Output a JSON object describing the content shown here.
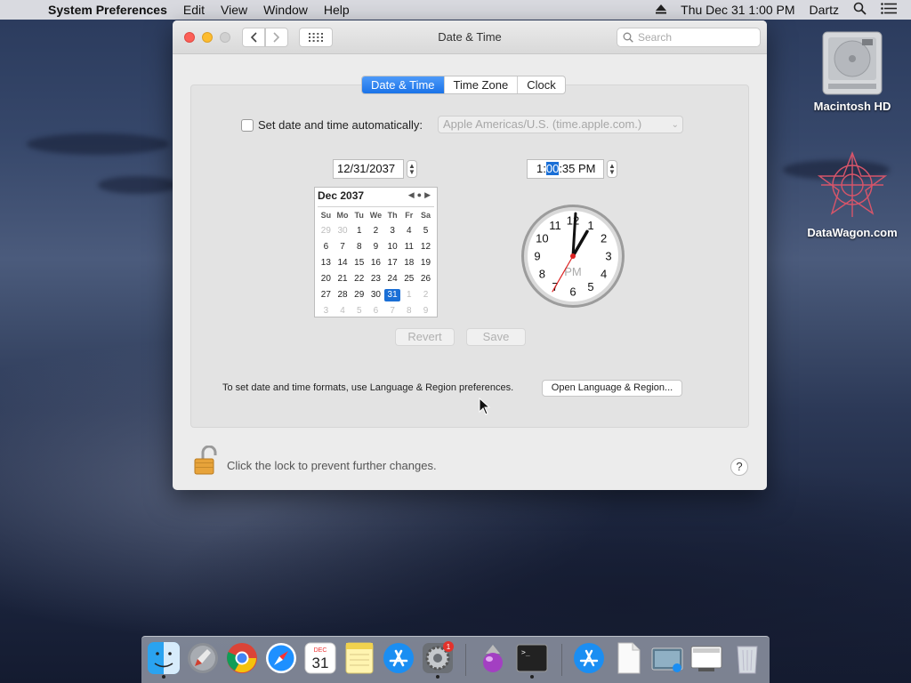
{
  "menubar": {
    "apple_glyph": "",
    "app_name": "System Preferences",
    "items": [
      "Edit",
      "View",
      "Window",
      "Help"
    ],
    "clock": "Thu Dec 31  1:00 PM",
    "user": "Dartz"
  },
  "window": {
    "title": "Date & Time",
    "search_placeholder": "Search",
    "tabs": [
      {
        "label": "Date & Time",
        "active": true
      },
      {
        "label": "Time Zone",
        "active": false
      },
      {
        "label": "Clock",
        "active": false
      }
    ],
    "auto_label": "Set date and time automatically:",
    "auto_checked": false,
    "time_server": "Apple Americas/U.S. (time.apple.com.)",
    "date_value": "12/31/2037",
    "time": {
      "hour": "1:",
      "minute": "00",
      "rest": ":35 PM"
    },
    "calendar": {
      "month_label": "Dec 2037",
      "dow": [
        "Su",
        "Mo",
        "Tu",
        "We",
        "Th",
        "Fr",
        "Sa"
      ],
      "weeks": [
        [
          [
            "29",
            "dim"
          ],
          [
            "30",
            "dim"
          ],
          [
            "1",
            ""
          ],
          [
            "2",
            ""
          ],
          [
            "3",
            ""
          ],
          [
            "4",
            ""
          ],
          [
            "5",
            ""
          ]
        ],
        [
          [
            "6",
            ""
          ],
          [
            "7",
            ""
          ],
          [
            "8",
            ""
          ],
          [
            "9",
            ""
          ],
          [
            "10",
            ""
          ],
          [
            "11",
            ""
          ],
          [
            "12",
            ""
          ]
        ],
        [
          [
            "13",
            ""
          ],
          [
            "14",
            ""
          ],
          [
            "15",
            ""
          ],
          [
            "16",
            ""
          ],
          [
            "17",
            ""
          ],
          [
            "18",
            ""
          ],
          [
            "19",
            ""
          ]
        ],
        [
          [
            "20",
            ""
          ],
          [
            "21",
            ""
          ],
          [
            "22",
            ""
          ],
          [
            "23",
            ""
          ],
          [
            "24",
            ""
          ],
          [
            "25",
            ""
          ],
          [
            "26",
            ""
          ]
        ],
        [
          [
            "27",
            ""
          ],
          [
            "28",
            ""
          ],
          [
            "29",
            ""
          ],
          [
            "30",
            ""
          ],
          [
            "31",
            "today"
          ],
          [
            "1",
            "dim"
          ],
          [
            "2",
            "dim"
          ]
        ],
        [
          [
            "3",
            "dim"
          ],
          [
            "4",
            "dim"
          ],
          [
            "5",
            "dim"
          ],
          [
            "6",
            "dim"
          ],
          [
            "7",
            "dim"
          ],
          [
            "8",
            "dim"
          ],
          [
            "9",
            "dim"
          ]
        ]
      ]
    },
    "clock_face": {
      "numbers": [
        "12",
        "1",
        "2",
        "3",
        "4",
        "5",
        "6",
        "7",
        "8",
        "9",
        "10",
        "11"
      ],
      "ampm": "PM",
      "hour": 1,
      "minute": 0,
      "second": 35
    },
    "revert_label": "Revert",
    "save_label": "Save",
    "hint": "To set date and time formats, use Language & Region preferences.",
    "open_region_label": "Open Language & Region...",
    "lock_text": "Click the lock to prevent further changes.",
    "help_label": "?"
  },
  "desktop": {
    "icons": [
      {
        "label": "Macintosh HD",
        "icon": "hard-drive-icon"
      },
      {
        "label": "DataWagon.com",
        "icon": "datawagon-logo-icon"
      }
    ]
  },
  "dock": {
    "items": [
      "finder-icon",
      "launchpad-icon",
      "chrome-icon",
      "safari-icon",
      "calendar-icon",
      "notes-icon",
      "app-store-icon",
      "system-preferences-icon",
      "installer-icon",
      "terminal-icon",
      "downloads-icon",
      "document-icon",
      "screenshot-icon",
      "xquartz-icon",
      "trash-icon"
    ],
    "calendar_month": "DEC",
    "calendar_day": "31",
    "badge": "1"
  },
  "colors": {
    "accent": "#1a73e8",
    "close": "#fc5f57",
    "minimize": "#fdbc2e"
  }
}
